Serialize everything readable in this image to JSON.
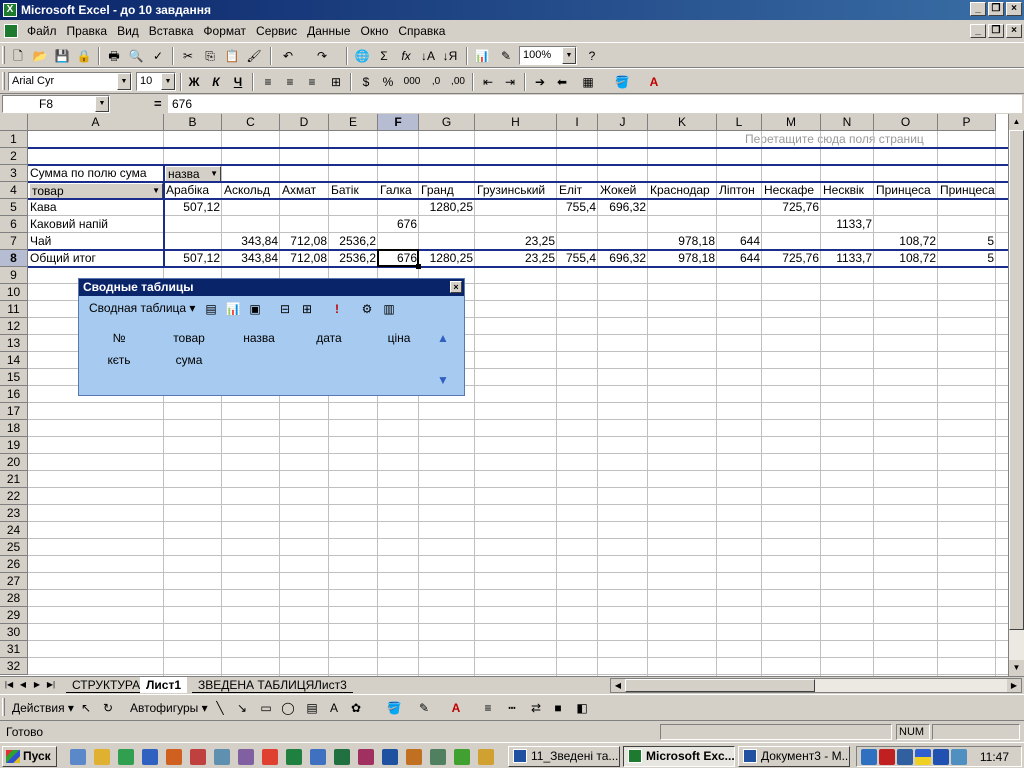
{
  "window": {
    "title": "Microsoft Excel - до 10 завдання"
  },
  "menu": [
    "Файл",
    "Правка",
    "Вид",
    "Вставка",
    "Формат",
    "Сервис",
    "Данные",
    "Окно",
    "Справка"
  ],
  "toolbar": {
    "zoom": "100%",
    "font_name": "Arial Cyr",
    "font_size": "10"
  },
  "formula_bar": {
    "name_box": "F8",
    "equals": "=",
    "value": "676"
  },
  "columns": [
    "A",
    "B",
    "C",
    "D",
    "E",
    "F",
    "G",
    "H",
    "I",
    "J",
    "K",
    "L",
    "M",
    "N",
    "O",
    "P"
  ],
  "rows": [
    "1",
    "2",
    "3",
    "4",
    "5",
    "6",
    "7",
    "8",
    "9",
    "10",
    "11",
    "12",
    "13",
    "14",
    "15",
    "16",
    "17",
    "18",
    "19",
    "20",
    "21",
    "22",
    "23",
    "24",
    "25",
    "26",
    "27",
    "28",
    "29",
    "30",
    "31",
    "32"
  ],
  "pivot": {
    "hint": "Перетащите сюда поля страниц",
    "data_label": "Сумма по полю сума",
    "col_field": "назва",
    "row_field": "товар",
    "headers": [
      "Арабіка",
      "Аскольд",
      "Ахмат",
      "Батік",
      "Галка",
      "Гранд",
      "Грузинський",
      "Еліт",
      "Жокей",
      "Краснодар",
      "Ліптон",
      "Нескафе",
      "Несквік",
      "Принцеса",
      "Принцеса Н"
    ],
    "row_labels": [
      "Кава",
      "Каковий напій",
      "Чай",
      "Общий итог"
    ],
    "values": {
      "kava": {
        "B": "507,12",
        "G": "1280,25",
        "I": "755,4",
        "J": "696,32",
        "M": "725,76"
      },
      "napiy": {
        "F": "676",
        "N": "1133,7"
      },
      "chai": {
        "C": "343,84",
        "D": "712,08",
        "E": "2536,2",
        "H": "23,25",
        "K": "978,18",
        "L": "644",
        "O": "108,72",
        "P": "5"
      },
      "total": {
        "B": "507,12",
        "C": "343,84",
        "D": "712,08",
        "E": "2536,2",
        "F": "676",
        "G": "1280,25",
        "H": "23,25",
        "I": "755,4",
        "J": "696,32",
        "K": "978,18",
        "L": "644",
        "M": "725,76",
        "N": "1133,7",
        "O": "108,72",
        "P": "5"
      }
    }
  },
  "pivot_toolbar": {
    "title": "Сводные таблицы",
    "menu": "Сводная таблица",
    "fields_row1": [
      "№",
      "товар",
      "назва",
      "дата",
      "ціна"
    ],
    "fields_row2": [
      "кєть",
      "сума"
    ]
  },
  "sheet_tabs": [
    "СТРУКТУРА",
    "Лист1",
    "ЗВЕДЕНА ТАБЛИЦЯ",
    "Лист3"
  ],
  "drawing": {
    "actions": "Действия",
    "autoshapes": "Автофигуры"
  },
  "status": {
    "text": "Готово",
    "num": "NUM"
  },
  "taskbar": {
    "start": "Пуск",
    "tasks": [
      "11_Зведені та...",
      "Microsoft Exc...",
      "Документ3 - М..."
    ],
    "clock": "11:47"
  },
  "colors": {
    "selection_blue": "#1a2c8c",
    "title_bar": "#0a246a",
    "pivot_toolbar_bg": "#a6caf0"
  }
}
